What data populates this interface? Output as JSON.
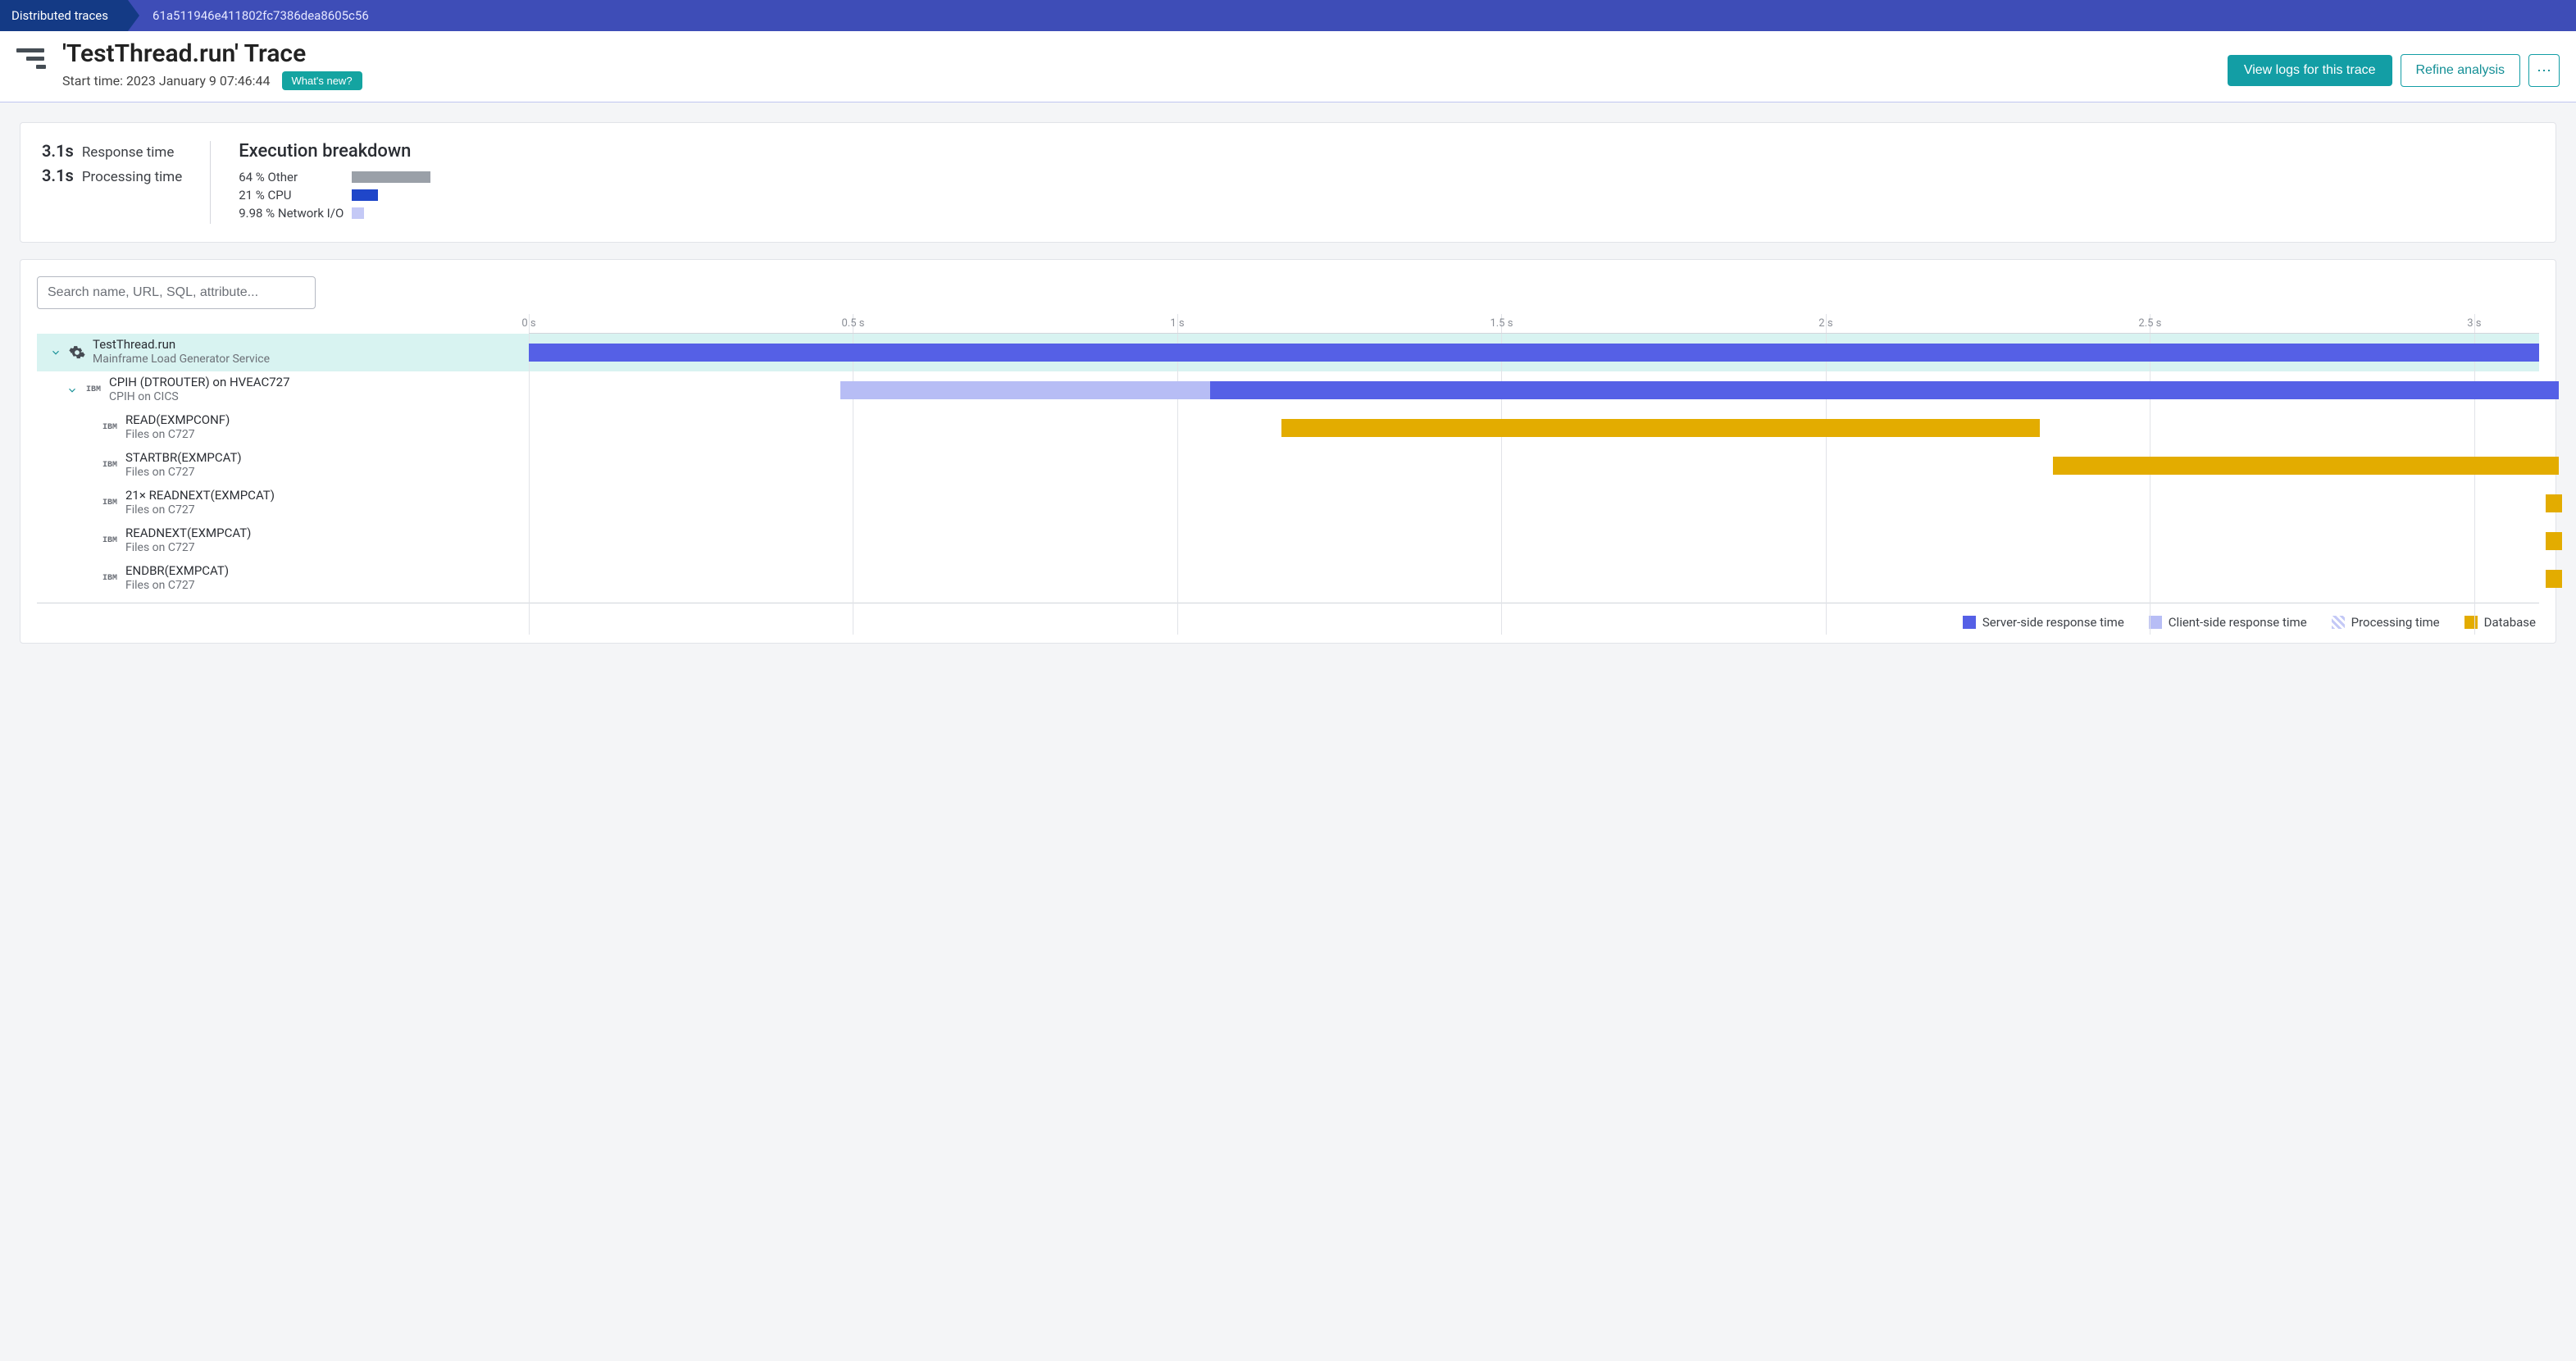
{
  "breadcrumb": {
    "root": "Distributed traces",
    "trace_id": "61a511946e411802fc7386dea8605c56"
  },
  "header": {
    "title": "'TestThread.run' Trace",
    "start_time_label": "Start time: 2023 January 9 07:46:44",
    "whats_new": "What's new?",
    "view_logs": "View logs for this trace",
    "refine": "Refine analysis"
  },
  "summary": {
    "response_time_value": "3.1s",
    "response_time_label": "Response time",
    "processing_time_value": "3.1s",
    "processing_time_label": "Processing time",
    "breakdown_title": "Execution breakdown",
    "rows": [
      {
        "label": "64 % Other",
        "pct": 64,
        "color": "#9aa0a8"
      },
      {
        "label": "21 % CPU",
        "pct": 21,
        "color": "#1f46c9"
      },
      {
        "label": "9.98 % Network I/O",
        "pct": 9.98,
        "color": "#c4c9f6"
      }
    ]
  },
  "search": {
    "placeholder": "Search name, URL, SQL, attribute..."
  },
  "timeline": {
    "max_s": 3.1,
    "ticks": [
      {
        "s": 0,
        "label": "0 s"
      },
      {
        "s": 0.5,
        "label": "0.5 s"
      },
      {
        "s": 1,
        "label": "1 s"
      },
      {
        "s": 1.5,
        "label": "1.5 s"
      },
      {
        "s": 2,
        "label": "2 s"
      },
      {
        "s": 2.5,
        "label": "2.5 s"
      },
      {
        "s": 3,
        "label": "3 s"
      }
    ]
  },
  "rows": [
    {
      "indent": 0,
      "expandable": true,
      "selected": true,
      "icon": "gear",
      "title": "TestThread.run",
      "sub": "Mainframe Load Generator Service",
      "segments": [
        {
          "start": 0,
          "end": 3.1,
          "color": "#5560e6"
        }
      ]
    },
    {
      "indent": 1,
      "expandable": true,
      "icon": "ibm",
      "title": "CPIH (DTROUTER) on HVEAC727",
      "sub": "CPIH on CICS",
      "segments": [
        {
          "start": 0.48,
          "end": 1.05,
          "color": "#b7bdf5"
        },
        {
          "start": 1.05,
          "end": 3.13,
          "color": "#5560e6"
        }
      ]
    },
    {
      "indent": 2,
      "expandable": false,
      "icon": "ibm",
      "title": "READ(EXMPCONF)",
      "sub": "Files on C727",
      "segments": [
        {
          "start": 1.16,
          "end": 2.33,
          "color": "#e3ac00"
        }
      ]
    },
    {
      "indent": 2,
      "expandable": false,
      "icon": "ibm",
      "title": "STARTBR(EXMPCAT)",
      "sub": "Files on C727",
      "segments": [
        {
          "start": 2.35,
          "end": 3.13,
          "color": "#e3ac00"
        }
      ]
    },
    {
      "indent": 2,
      "expandable": false,
      "icon": "ibm",
      "title": "21× READNEXT(EXMPCAT)",
      "sub": "Files on C727",
      "segments": [
        {
          "start": 3.11,
          "end": 3.135,
          "color": "#e3ac00"
        }
      ]
    },
    {
      "indent": 2,
      "expandable": false,
      "icon": "ibm",
      "title": "READNEXT(EXMPCAT)",
      "sub": "Files on C727",
      "segments": [
        {
          "start": 3.11,
          "end": 3.135,
          "color": "#e3ac00"
        }
      ]
    },
    {
      "indent": 2,
      "expandable": false,
      "icon": "ibm",
      "title": "ENDBR(EXMPCAT)",
      "sub": "Files on C727",
      "segments": [
        {
          "start": 3.11,
          "end": 3.135,
          "color": "#e3ac00"
        }
      ]
    }
  ],
  "legend": {
    "server": "Server-side response time",
    "client": "Client-side response time",
    "processing": "Processing time",
    "database": "Database"
  },
  "colors": {
    "server": "#5560e6",
    "client": "#b7bdf5",
    "database": "#e3ac00"
  }
}
